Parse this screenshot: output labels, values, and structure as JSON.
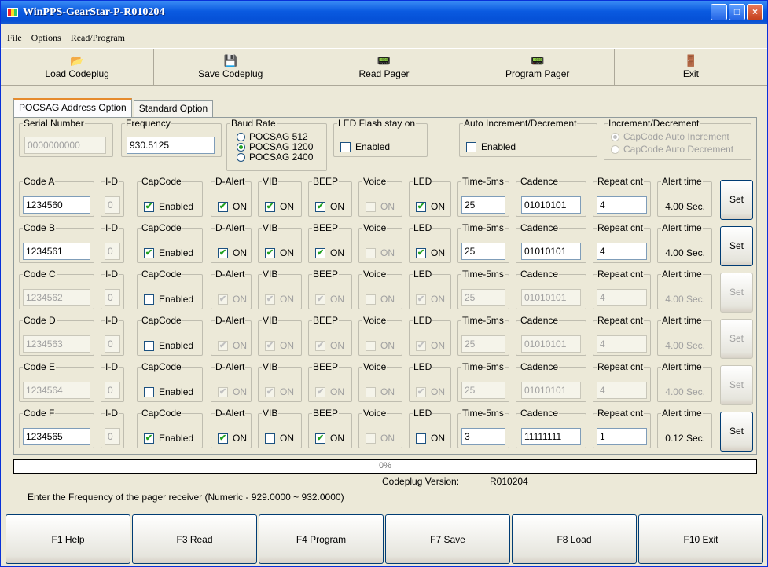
{
  "window": {
    "title": "WinPPS-GearStar-P-R010204",
    "minimize": "_",
    "maximize": "□",
    "close": "×"
  },
  "menu": [
    "File",
    "Options",
    "Read/Program"
  ],
  "toolbar": [
    {
      "label": "Load Codeplug",
      "icon": "open-folder-icon",
      "glyph": "📂"
    },
    {
      "label": "Save Codeplug",
      "icon": "floppy-disk-icon",
      "glyph": "💾"
    },
    {
      "label": "Read Pager",
      "icon": "read-pager-icon",
      "glyph": "📟"
    },
    {
      "label": "Program Pager",
      "icon": "program-pager-icon",
      "glyph": "📟"
    },
    {
      "label": "Exit",
      "icon": "exit-door-icon",
      "glyph": "🚪"
    }
  ],
  "tabs": [
    "POCSAG Address Option",
    "Standard Option"
  ],
  "serial": {
    "label": "Serial Number",
    "value": "0000000000"
  },
  "frequency": {
    "label": "Frequency",
    "value": "930.5125"
  },
  "baud": {
    "label": "Baud Rate",
    "options": [
      "POCSAG 512",
      "POCSAG 1200",
      "POCSAG 2400"
    ],
    "selected": "POCSAG 1200"
  },
  "led_flash": {
    "label": "LED Flash stay on",
    "option": "Enabled",
    "checked": false
  },
  "auto_inc": {
    "label": "Auto Increment/Decrement",
    "option": "Enabled",
    "checked": false
  },
  "inc_dec": {
    "label": "Increment/Decrement",
    "options": [
      "CapCode Auto Increment",
      "CapCode Auto Decrement"
    ],
    "selected": "CapCode Auto Increment"
  },
  "labels": {
    "id": "I-D",
    "capcode": "CapCode",
    "dalert": "D-Alert",
    "vib": "VIB",
    "beep": "BEEP",
    "voice": "Voice",
    "led": "LED",
    "time": "Time-5ms",
    "cadence": "Cadence",
    "repeat": "Repeat cnt",
    "alert": "Alert time",
    "enabled": "Enabled",
    "on": "ON",
    "set": "Set"
  },
  "codes": [
    {
      "label": "Code A",
      "code": "1234560",
      "id": "0",
      "capcode": true,
      "dalert": true,
      "vib": true,
      "beep": true,
      "voice": false,
      "led": true,
      "time": "25",
      "cadence": "01010101",
      "repeat": "4",
      "alert": "4.00 Sec."
    },
    {
      "label": "Code B",
      "code": "1234561",
      "id": "0",
      "capcode": true,
      "dalert": true,
      "vib": true,
      "beep": true,
      "voice": false,
      "led": true,
      "time": "25",
      "cadence": "01010101",
      "repeat": "4",
      "alert": "4.00 Sec."
    },
    {
      "label": "Code C",
      "code": "1234562",
      "id": "0",
      "capcode": false,
      "dalert": true,
      "vib": true,
      "beep": true,
      "voice": false,
      "led": true,
      "time": "25",
      "cadence": "01010101",
      "repeat": "4",
      "alert": "4.00 Sec."
    },
    {
      "label": "Code D",
      "code": "1234563",
      "id": "0",
      "capcode": false,
      "dalert": true,
      "vib": true,
      "beep": true,
      "voice": false,
      "led": true,
      "time": "25",
      "cadence": "01010101",
      "repeat": "4",
      "alert": "4.00 Sec."
    },
    {
      "label": "Code E",
      "code": "1234564",
      "id": "0",
      "capcode": false,
      "dalert": true,
      "vib": true,
      "beep": true,
      "voice": false,
      "led": true,
      "time": "25",
      "cadence": "01010101",
      "repeat": "4",
      "alert": "4.00 Sec."
    },
    {
      "label": "Code F",
      "code": "1234565",
      "id": "0",
      "capcode": true,
      "dalert": true,
      "vib": false,
      "beep": true,
      "voice": false,
      "led": false,
      "time": "3",
      "cadence": "11111111",
      "repeat": "1",
      "alert": "0.12 Sec."
    }
  ],
  "progress": {
    "fraction": 0,
    "text": "0%"
  },
  "codeplug": {
    "label": "Codeplug Version:",
    "value": "R010204"
  },
  "hint": "Enter the Frequency of the pager receiver (Numeric - 929.0000 ~ 932.0000)",
  "fkeys": [
    "F1 Help",
    "F3 Read",
    "F4 Program",
    "F7 Save",
    "F8 Load",
    "F10 Exit"
  ]
}
